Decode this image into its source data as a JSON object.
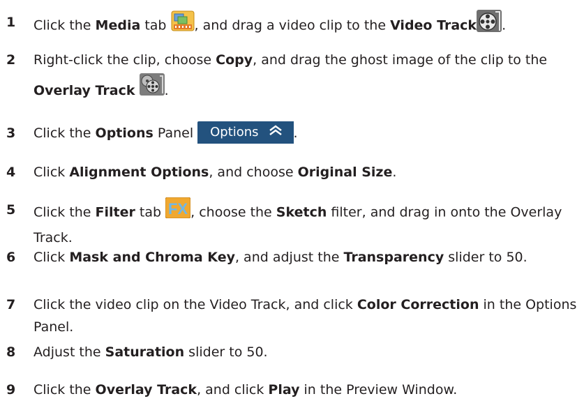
{
  "steps": [
    {
      "num": "1",
      "parts": [
        "Click the ",
        "Media",
        " tab ",
        ", and drag a video clip to the ",
        "Video Track",
        "."
      ],
      "icons": [
        "media-tab-icon",
        "video-track-icon"
      ]
    },
    {
      "num": "2",
      "parts": [
        "Right-click the clip, choose ",
        "Copy",
        ", and drag the ghost image of the clip to the ",
        "Overlay Track",
        "."
      ],
      "icons": [
        "overlay-track-icon"
      ]
    },
    {
      "num": "3",
      "parts": [
        "Click the ",
        "Options",
        " Panel",
        "."
      ],
      "button": {
        "label": "Options",
        "icon": "chevron-up-double-icon"
      }
    },
    {
      "num": "4",
      "parts": [
        "Click ",
        "Alignment Options",
        ", and choose ",
        "Original Size",
        "."
      ]
    },
    {
      "num": "5",
      "parts": [
        "Click the ",
        "Filter",
        " tab ",
        ", choose the ",
        "Sketch",
        " filter, and drag in onto the Overlay Track."
      ],
      "icons": [
        "fx-filter-tab-icon"
      ]
    },
    {
      "num": "6",
      "parts": [
        "Click ",
        "Mask and Chroma Key",
        ", and adjust the ",
        "Transparency",
        " slider to 50."
      ]
    },
    {
      "num": "7",
      "parts": [
        "Click the video clip on the Video Track, and click ",
        "Color Correction",
        " in the Options Panel."
      ]
    },
    {
      "num": "8",
      "parts": [
        "Adjust the ",
        "Saturation",
        " slider to 50."
      ]
    },
    {
      "num": "9",
      "parts": [
        "Click the ",
        "Overlay Track",
        ", and click ",
        "Play",
        " in the Preview Window."
      ]
    }
  ],
  "colors": {
    "text": "#231f20",
    "options_button_bg": "#23527e",
    "fx_icon": "#f0a830"
  }
}
